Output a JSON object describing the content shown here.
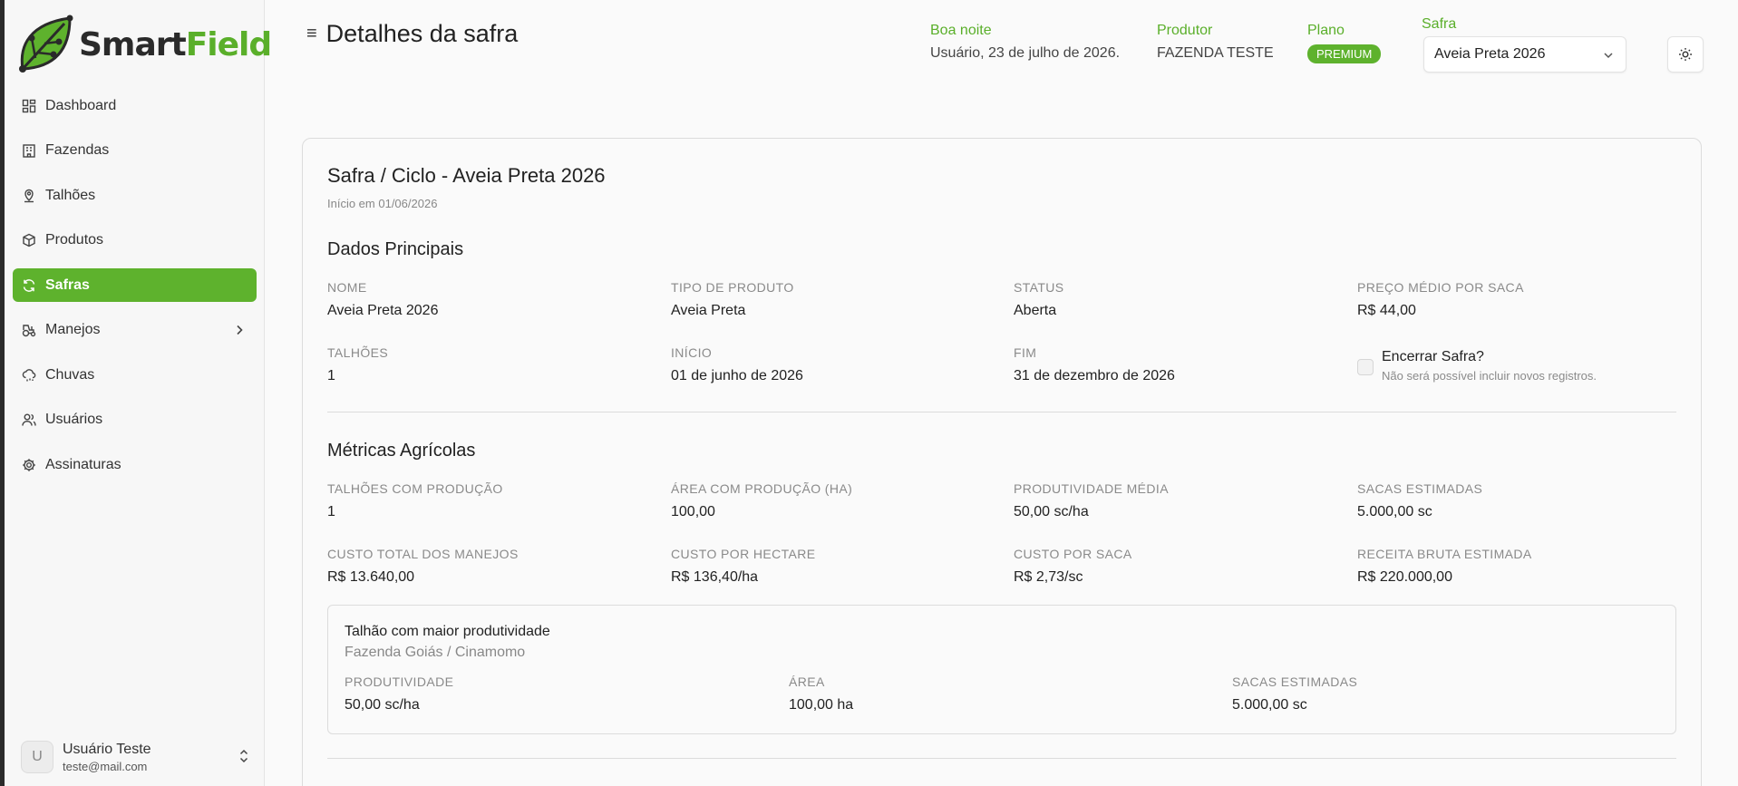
{
  "brand": {
    "smart": "Smart",
    "field": "Field",
    "accent": "#5eb22d"
  },
  "sidebar": {
    "items": [
      {
        "label": "Dashboard",
        "icon": "dashboard-icon"
      },
      {
        "label": "Fazendas",
        "icon": "building-icon"
      },
      {
        "label": "Talhões",
        "icon": "map-pin-icon"
      },
      {
        "label": "Produtos",
        "icon": "package-icon"
      },
      {
        "label": "Safras",
        "icon": "refresh-icon",
        "active": true
      },
      {
        "label": "Manejos",
        "icon": "tractor-icon",
        "has_submenu": true
      },
      {
        "label": "Chuvas",
        "icon": "cloud-rain-icon"
      },
      {
        "label": "Usuários",
        "icon": "users-icon"
      },
      {
        "label": "Assinaturas",
        "icon": "gear-icon"
      }
    ],
    "user": {
      "initial": "U",
      "name": "Usuário Teste",
      "email": "teste@mail.com"
    }
  },
  "header": {
    "title": "Detalhes da safra",
    "greeting_label": "Boa noite",
    "greeting_value": "Usuário, 23 de julho de 2026.",
    "producer_label": "Produtor",
    "producer_value": "FAZENDA TESTE",
    "plan_label": "Plano",
    "plan_value": "PREMIUM",
    "safra_label": "Safra",
    "safra_selected": "Aveia Preta 2026"
  },
  "card": {
    "title": "Safra / Ciclo - Aveia Preta 2026",
    "subtitle": "Início em 01/06/2026",
    "main_section": {
      "title": "Dados Principais",
      "fields": [
        {
          "label": "NOME",
          "value": "Aveia Preta 2026"
        },
        {
          "label": "TIPO DE PRODUTO",
          "value": "Aveia Preta"
        },
        {
          "label": "STATUS",
          "value": "Aberta"
        },
        {
          "label": "PREÇO MÉDIO POR SACA",
          "value": "R$ 44,00"
        },
        {
          "label": "TALHÕES",
          "value": "1"
        },
        {
          "label": "INÍCIO",
          "value": "01 de junho de 2026"
        },
        {
          "label": "FIM",
          "value": "31 de dezembro de 2026"
        }
      ],
      "close_checkbox": {
        "label": "Encerrar Safra?",
        "hint": "Não será possível incluir novos registros.",
        "checked": false
      }
    },
    "metrics_section": {
      "title": "Métricas Agrícolas",
      "fields": [
        {
          "label": "TALHÕES COM PRODUÇÃO",
          "value": "1"
        },
        {
          "label": "ÁREA COM PRODUÇÃO (HA)",
          "value": "100,00"
        },
        {
          "label": "PRODUTIVIDADE MÉDIA",
          "value": "50,00 sc/ha"
        },
        {
          "label": "SACAS ESTIMADAS",
          "value": "5.000,00 sc"
        },
        {
          "label": "CUSTO TOTAL DOS MANEJOS",
          "value": "R$ 13.640,00"
        },
        {
          "label": "CUSTO POR HECTARE",
          "value": "R$ 136,40/ha"
        },
        {
          "label": "CUSTO POR SACA",
          "value": "R$ 2,73/sc"
        },
        {
          "label": "RECEITA BRUTA ESTIMADA",
          "value": "R$ 220.000,00"
        }
      ],
      "best_plot": {
        "title": "Talhão com maior produtividade",
        "subtitle": "Fazenda Goiás / Cinamomo",
        "fields": [
          {
            "label": "PRODUTIVIDADE",
            "value": "50,00 sc/ha"
          },
          {
            "label": "ÁREA",
            "value": "100,00 ha"
          },
          {
            "label": "SACAS ESTIMADAS",
            "value": "5.000,00 sc"
          }
        ]
      }
    }
  }
}
